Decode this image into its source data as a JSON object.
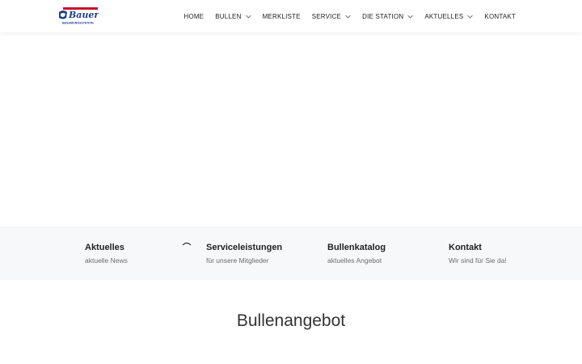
{
  "header": {
    "logo": {
      "icon": "bauer-logo",
      "brand": "Bauer",
      "tagline": "BESAMUNGSSTATION"
    },
    "nav": [
      {
        "label": "HOME",
        "has_submenu": false
      },
      {
        "label": "BULLEN",
        "has_submenu": true
      },
      {
        "label": "MERKLISTE",
        "has_submenu": false
      },
      {
        "label": "SERVICE",
        "has_submenu": true
      },
      {
        "label": "DIE STATION",
        "has_submenu": true
      },
      {
        "label": "AKTUELLES",
        "has_submenu": true
      },
      {
        "label": "KONTAKT",
        "has_submenu": false
      }
    ]
  },
  "features": [
    {
      "title": "Aktuelles",
      "subtitle": "aktuelle News"
    },
    {
      "title": "Serviceleistungen",
      "subtitle": "für unsere Mitglieder"
    },
    {
      "title": "Bullenkatalog",
      "subtitle": "aktuelles Angebot"
    },
    {
      "title": "Kontakt",
      "subtitle": "Wir sind für Sie da!"
    }
  ],
  "main": {
    "section_title": "Bullenangebot"
  },
  "colors": {
    "brand_blue": "#1d3f8f",
    "brand_red": "#c8102e",
    "band_bg": "#f6f8fa"
  }
}
